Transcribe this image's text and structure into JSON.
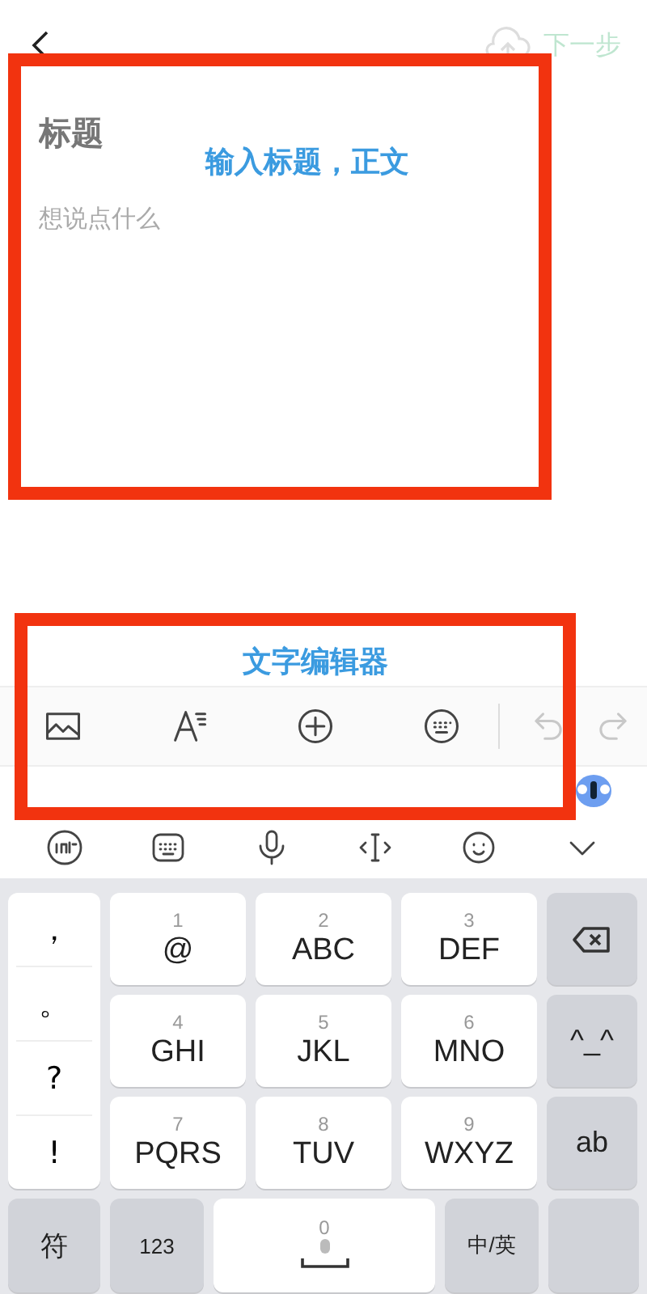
{
  "top_bar": {
    "next": {
      "label": "下一步",
      "disabled": true
    }
  },
  "editor": {
    "title": {
      "placeholder": "标题"
    },
    "body": {
      "placeholder": "想说点什么"
    }
  },
  "format_toolbar": [
    {
      "kind": "image",
      "disabled": false
    },
    {
      "kind": "font",
      "disabled": false
    },
    {
      "kind": "add",
      "disabled": false
    },
    {
      "kind": "keyboard",
      "disabled": false
    },
    {
      "kind": "undo",
      "disabled": true
    },
    {
      "kind": "redo",
      "disabled": true
    }
  ],
  "keyboard": {
    "tools": [
      {
        "kind": "ime"
      },
      {
        "kind": "keyboard"
      },
      {
        "kind": "mic"
      },
      {
        "kind": "cursor"
      },
      {
        "kind": "emoji"
      },
      {
        "kind": "collapse"
      }
    ],
    "symbols": [
      "，",
      "。",
      "?",
      "!"
    ],
    "keys": [
      {
        "digit": "1",
        "label": "@"
      },
      {
        "digit": "2",
        "label": "ABC"
      },
      {
        "digit": "3",
        "label": "DEF"
      },
      {
        "digit": "4",
        "label": "GHI"
      },
      {
        "digit": "5",
        "label": "JKL"
      },
      {
        "digit": "6",
        "label": "MNO"
      },
      {
        "digit": "7",
        "label": "PQRS"
      },
      {
        "digit": "8",
        "label": "TUV"
      },
      {
        "digit": "9",
        "label": "WXYZ"
      }
    ],
    "side_keys": [
      {
        "kind": "backspace"
      },
      {
        "kind": "text",
        "label": "^_^"
      },
      {
        "kind": "text",
        "label": "ab"
      }
    ],
    "bottom_keys": [
      {
        "kind": "text",
        "label": "符"
      },
      {
        "kind": "text",
        "label": "123"
      },
      {
        "kind": "space",
        "digit": "0"
      },
      {
        "kind": "text",
        "label": "中/英"
      },
      {
        "kind": "blank"
      }
    ]
  },
  "annotations": [
    {
      "text": "输入标题，正文"
    },
    {
      "text": "文字编辑器"
    }
  ]
}
